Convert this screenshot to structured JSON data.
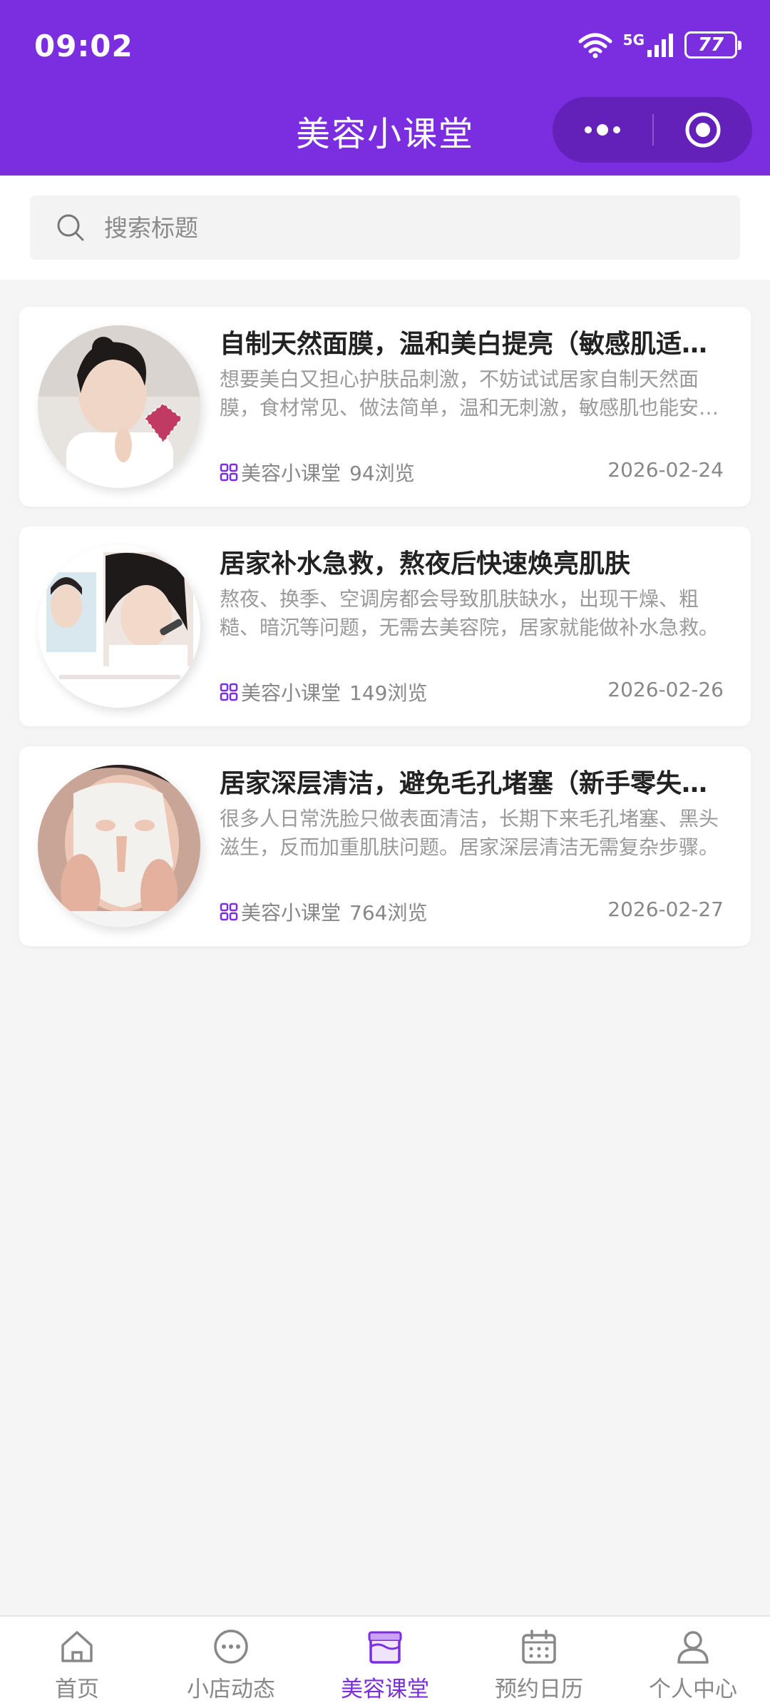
{
  "status_bar": {
    "time": "09:02",
    "network": "5G",
    "battery": "77"
  },
  "header": {
    "title": "美容小课堂"
  },
  "search": {
    "placeholder": "搜索标题"
  },
  "articles": [
    {
      "title": "自制天然面膜，温和美白提亮（敏感肌适用）",
      "excerpt": "想要美白又担心护肤品刺激，不妨试试居家自制天然面膜，食材常见、做法简单，温和无刺激，敏感肌也能安心使用。",
      "category": "美容小课堂",
      "views": "94浏览",
      "date": "2026-02-24"
    },
    {
      "title": "居家补水急救，熬夜后快速焕亮肌肤",
      "excerpt": "熬夜、换季、空调房都会导致肌肤缺水，出现干燥、粗糙、暗沉等问题，无需去美容院，居家就能做补水急救。",
      "category": "美容小课堂",
      "views": "149浏览",
      "date": "2026-02-26"
    },
    {
      "title": "居家深层清洁，避免毛孔堵塞（新手零失误）",
      "excerpt": "很多人日常洗脸只做表面清洁，长期下来毛孔堵塞、黑头滋生，反而加重肌肤问题。居家深层清洁无需复杂步骤。",
      "category": "美容小课堂",
      "views": "764浏览",
      "date": "2026-02-27"
    }
  ],
  "tabbar": {
    "items": [
      {
        "label": "首页",
        "icon": "home-icon"
      },
      {
        "label": "小店动态",
        "icon": "chat-bubble-icon"
      },
      {
        "label": "美容课堂",
        "icon": "classroom-icon"
      },
      {
        "label": "预约日历",
        "icon": "calendar-icon"
      },
      {
        "label": "个人中心",
        "icon": "user-icon"
      }
    ],
    "active_index": 2
  },
  "colors": {
    "brand": "#7b2ee0",
    "background": "#f5f5f5",
    "text_primary": "#222222",
    "text_secondary": "#9a9a9a"
  }
}
